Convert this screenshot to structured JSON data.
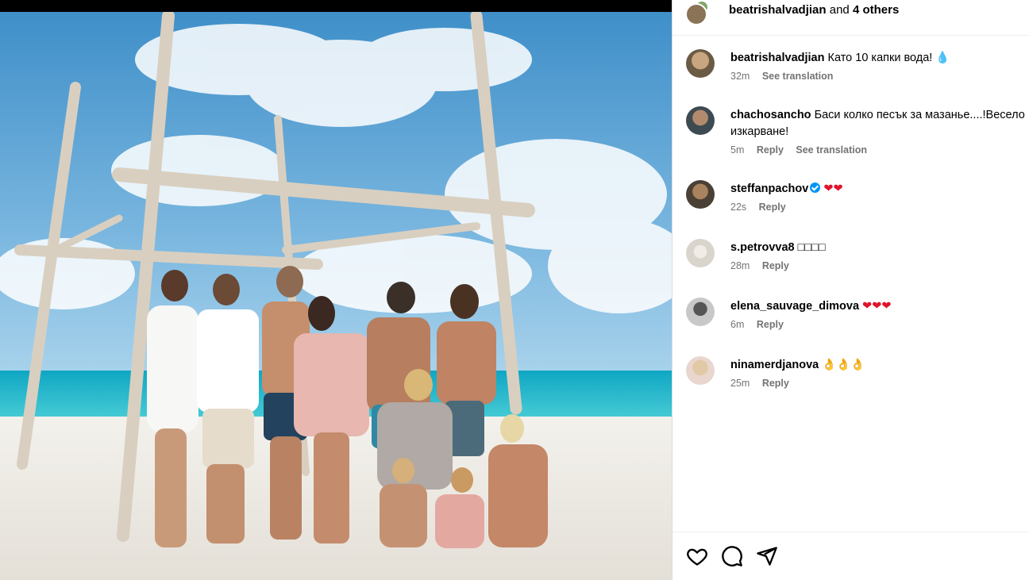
{
  "header": {
    "username": "beatrishalvadjian",
    "and_text": " and ",
    "others": "4 others"
  },
  "comments": [
    {
      "username": "beatrishalvadjian",
      "text": "Като 10 капки вода! 💧",
      "time": "32m",
      "see_translation": "See translation",
      "avatar_color": "#6b5a44"
    },
    {
      "username": "chachosancho",
      "text": "Баси колко песък за мазанье....!Весело изкарване!",
      "time": "5m",
      "reply": "Reply",
      "see_translation": "See translation",
      "avatar_color": "#3d4a52"
    },
    {
      "username": "steffanpachov",
      "text": "❤❤",
      "time": "22s",
      "reply": "Reply",
      "verified": true,
      "avatar_color": "#4a4035"
    },
    {
      "username": "s.petrovva8",
      "text": "□□□□",
      "time": "28m",
      "reply": "Reply",
      "avatar_color": "#d9d4cc"
    },
    {
      "username": "elena_sauvage_dimova",
      "text": "❤❤❤",
      "time": "6m",
      "reply": "Reply",
      "avatar_color": "#9a9a9a"
    },
    {
      "username": "ninamerdjanova",
      "text": "👌👌👌",
      "time": "25m",
      "reply": "Reply",
      "avatar_color": "#e8d6cf"
    }
  ],
  "actions": {
    "icons": [
      "heart-icon",
      "comment-icon",
      "share-icon"
    ]
  },
  "colors": {
    "muted": "#737373",
    "verified": "#0095f6",
    "heart": "#e0142b",
    "border": "#dbdbdb"
  }
}
